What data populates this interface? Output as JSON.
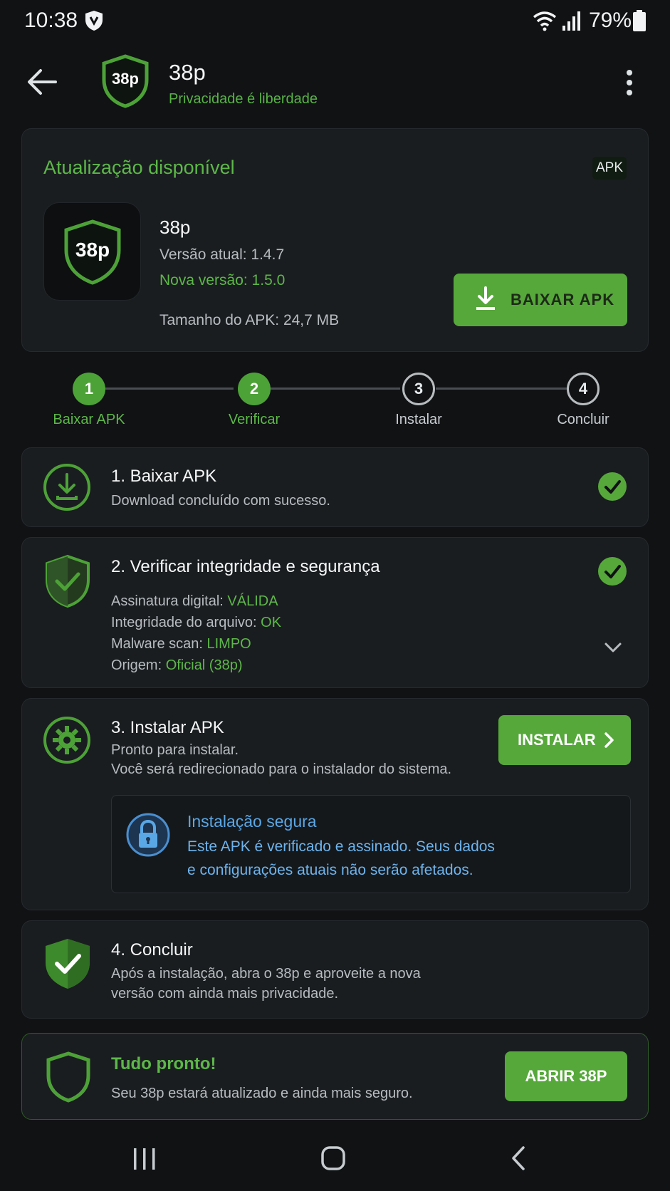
{
  "status_bar": {
    "time": "10:38",
    "battery": "79%"
  },
  "app_bar": {
    "title": "38p",
    "subtitle": "Privacidade é liberdade",
    "logo_text": "38p"
  },
  "update": {
    "heading": "Atualização disponível",
    "badge": "APK",
    "icon_text": "38p",
    "app_name": "38p",
    "current_version": "Versão atual: 1.4.7",
    "new_version": "Nova versão: 1.5.0",
    "apk_size": "Tamanho do APK: 24,7 MB",
    "download_label": "BAIXAR APK"
  },
  "stepper": [
    {
      "num": "1",
      "label": "Baixar APK",
      "state": "done"
    },
    {
      "num": "2",
      "label": "Verificar",
      "state": "done"
    },
    {
      "num": "3",
      "label": "Instalar",
      "state": "todo"
    },
    {
      "num": "4",
      "label": "Concluir",
      "state": "todo"
    }
  ],
  "step1": {
    "title": "1. Baixar APK",
    "text": "Download concluído com sucesso."
  },
  "step2": {
    "title": "2. Verificar integridade e segurança",
    "checks": [
      {
        "label": "Assinatura digital: ",
        "value": "VÁLIDA"
      },
      {
        "label": "Integridade do arquivo: ",
        "value": "OK"
      },
      {
        "label": "Malware scan: ",
        "value": "LIMPO"
      },
      {
        "label": "Origem: ",
        "value": "Oficial (38p)"
      }
    ]
  },
  "step3": {
    "title": "3. Instalar APK",
    "line1": "Pronto para instalar.",
    "line2": "Você será redirecionado para o instalador do sistema.",
    "button": "INSTALAR",
    "secure_title": "Instalação segura",
    "secure_line1": "Este APK é verificado e assinado. Seus dados",
    "secure_line2": "e configurações atuais não serão afetados."
  },
  "step4": {
    "title": "4. Concluir",
    "line1": "Após a instalação, abra o 38p e aproveite a nova",
    "line2": "versão com ainda mais privacidade."
  },
  "ready": {
    "title": "Tudo pronto!",
    "text": "Seu 38p estará atualizado e ainda mais seguro.",
    "button": "ABRIR 38P"
  },
  "colors": {
    "accent": "#56a83b",
    "accent_text": "#5db849",
    "info_blue": "#5aa7e6",
    "background": "#101214",
    "card": "#1a1d20"
  }
}
